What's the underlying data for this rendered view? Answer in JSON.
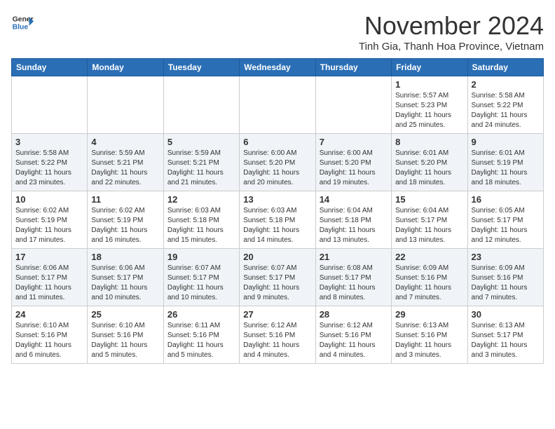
{
  "header": {
    "logo_line1": "General",
    "logo_line2": "Blue",
    "month": "November 2024",
    "location": "Tinh Gia, Thanh Hoa Province, Vietnam"
  },
  "weekdays": [
    "Sunday",
    "Monday",
    "Tuesday",
    "Wednesday",
    "Thursday",
    "Friday",
    "Saturday"
  ],
  "weeks": [
    [
      {
        "day": "",
        "info": ""
      },
      {
        "day": "",
        "info": ""
      },
      {
        "day": "",
        "info": ""
      },
      {
        "day": "",
        "info": ""
      },
      {
        "day": "",
        "info": ""
      },
      {
        "day": "1",
        "info": "Sunrise: 5:57 AM\nSunset: 5:23 PM\nDaylight: 11 hours and 25 minutes."
      },
      {
        "day": "2",
        "info": "Sunrise: 5:58 AM\nSunset: 5:22 PM\nDaylight: 11 hours and 24 minutes."
      }
    ],
    [
      {
        "day": "3",
        "info": "Sunrise: 5:58 AM\nSunset: 5:22 PM\nDaylight: 11 hours and 23 minutes."
      },
      {
        "day": "4",
        "info": "Sunrise: 5:59 AM\nSunset: 5:21 PM\nDaylight: 11 hours and 22 minutes."
      },
      {
        "day": "5",
        "info": "Sunrise: 5:59 AM\nSunset: 5:21 PM\nDaylight: 11 hours and 21 minutes."
      },
      {
        "day": "6",
        "info": "Sunrise: 6:00 AM\nSunset: 5:20 PM\nDaylight: 11 hours and 20 minutes."
      },
      {
        "day": "7",
        "info": "Sunrise: 6:00 AM\nSunset: 5:20 PM\nDaylight: 11 hours and 19 minutes."
      },
      {
        "day": "8",
        "info": "Sunrise: 6:01 AM\nSunset: 5:20 PM\nDaylight: 11 hours and 18 minutes."
      },
      {
        "day": "9",
        "info": "Sunrise: 6:01 AM\nSunset: 5:19 PM\nDaylight: 11 hours and 18 minutes."
      }
    ],
    [
      {
        "day": "10",
        "info": "Sunrise: 6:02 AM\nSunset: 5:19 PM\nDaylight: 11 hours and 17 minutes."
      },
      {
        "day": "11",
        "info": "Sunrise: 6:02 AM\nSunset: 5:19 PM\nDaylight: 11 hours and 16 minutes."
      },
      {
        "day": "12",
        "info": "Sunrise: 6:03 AM\nSunset: 5:18 PM\nDaylight: 11 hours and 15 minutes."
      },
      {
        "day": "13",
        "info": "Sunrise: 6:03 AM\nSunset: 5:18 PM\nDaylight: 11 hours and 14 minutes."
      },
      {
        "day": "14",
        "info": "Sunrise: 6:04 AM\nSunset: 5:18 PM\nDaylight: 11 hours and 13 minutes."
      },
      {
        "day": "15",
        "info": "Sunrise: 6:04 AM\nSunset: 5:17 PM\nDaylight: 11 hours and 13 minutes."
      },
      {
        "day": "16",
        "info": "Sunrise: 6:05 AM\nSunset: 5:17 PM\nDaylight: 11 hours and 12 minutes."
      }
    ],
    [
      {
        "day": "17",
        "info": "Sunrise: 6:06 AM\nSunset: 5:17 PM\nDaylight: 11 hours and 11 minutes."
      },
      {
        "day": "18",
        "info": "Sunrise: 6:06 AM\nSunset: 5:17 PM\nDaylight: 11 hours and 10 minutes."
      },
      {
        "day": "19",
        "info": "Sunrise: 6:07 AM\nSunset: 5:17 PM\nDaylight: 11 hours and 10 minutes."
      },
      {
        "day": "20",
        "info": "Sunrise: 6:07 AM\nSunset: 5:17 PM\nDaylight: 11 hours and 9 minutes."
      },
      {
        "day": "21",
        "info": "Sunrise: 6:08 AM\nSunset: 5:17 PM\nDaylight: 11 hours and 8 minutes."
      },
      {
        "day": "22",
        "info": "Sunrise: 6:09 AM\nSunset: 5:16 PM\nDaylight: 11 hours and 7 minutes."
      },
      {
        "day": "23",
        "info": "Sunrise: 6:09 AM\nSunset: 5:16 PM\nDaylight: 11 hours and 7 minutes."
      }
    ],
    [
      {
        "day": "24",
        "info": "Sunrise: 6:10 AM\nSunset: 5:16 PM\nDaylight: 11 hours and 6 minutes."
      },
      {
        "day": "25",
        "info": "Sunrise: 6:10 AM\nSunset: 5:16 PM\nDaylight: 11 hours and 5 minutes."
      },
      {
        "day": "26",
        "info": "Sunrise: 6:11 AM\nSunset: 5:16 PM\nDaylight: 11 hours and 5 minutes."
      },
      {
        "day": "27",
        "info": "Sunrise: 6:12 AM\nSunset: 5:16 PM\nDaylight: 11 hours and 4 minutes."
      },
      {
        "day": "28",
        "info": "Sunrise: 6:12 AM\nSunset: 5:16 PM\nDaylight: 11 hours and 4 minutes."
      },
      {
        "day": "29",
        "info": "Sunrise: 6:13 AM\nSunset: 5:16 PM\nDaylight: 11 hours and 3 minutes."
      },
      {
        "day": "30",
        "info": "Sunrise: 6:13 AM\nSunset: 5:17 PM\nDaylight: 11 hours and 3 minutes."
      }
    ]
  ]
}
